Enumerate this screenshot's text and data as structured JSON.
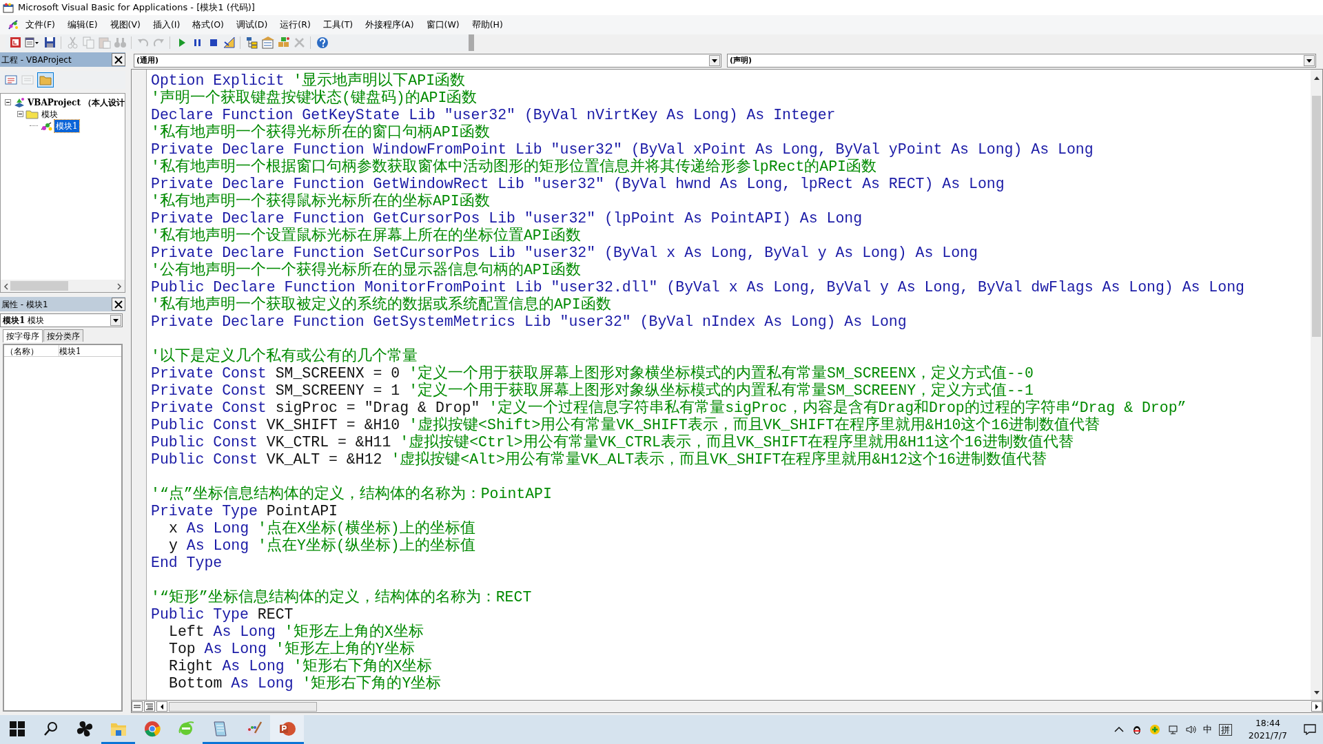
{
  "window": {
    "title": "Microsoft Visual Basic for Applications - [模块1 (代码)]"
  },
  "menu": [
    "文件(F)",
    "编辑(E)",
    "视图(V)",
    "插入(I)",
    "格式(O)",
    "调试(D)",
    "运行(R)",
    "工具(T)",
    "外接程序(A)",
    "窗口(W)",
    "帮助(H)"
  ],
  "toolbar": [
    {
      "kind": "host",
      "disabled": false
    },
    {
      "kind": "insert",
      "disabled": false
    },
    {
      "kind": "save",
      "disabled": false
    },
    {
      "kind": "separator"
    },
    {
      "kind": "cut",
      "disabled": true
    },
    {
      "kind": "copy",
      "disabled": true
    },
    {
      "kind": "paste",
      "disabled": true
    },
    {
      "kind": "find",
      "disabled": true
    },
    {
      "kind": "separator"
    },
    {
      "kind": "undo",
      "disabled": true
    },
    {
      "kind": "redo",
      "disabled": true
    },
    {
      "kind": "separator"
    },
    {
      "kind": "run",
      "disabled": false
    },
    {
      "kind": "pause",
      "disabled": false
    },
    {
      "kind": "stop",
      "disabled": false
    },
    {
      "kind": "design",
      "disabled": false
    },
    {
      "kind": "separator"
    },
    {
      "kind": "project",
      "disabled": false
    },
    {
      "kind": "properties",
      "disabled": false
    },
    {
      "kind": "objects",
      "disabled": false
    },
    {
      "kind": "toolbox",
      "disabled": true
    },
    {
      "kind": "separator"
    },
    {
      "kind": "help",
      "disabled": false
    }
  ],
  "project_panel": {
    "title": "工程 - VBAProject",
    "tree": [
      {
        "label": "VBAProject （本人设计",
        "expanded": true,
        "selected": false,
        "children": [
          {
            "label": "模块",
            "expanded": true,
            "selected": false,
            "children": [
              {
                "label": "模块1",
                "selected": true
              }
            ]
          }
        ]
      }
    ]
  },
  "properties_panel": {
    "title": "属性 - 模块1",
    "object": "模块1",
    "object_type": "模块",
    "tabs": [
      {
        "label": "按字母序",
        "selected": true
      },
      {
        "label": "按分类序",
        "selected": false
      }
    ],
    "rows": [
      {
        "name": "（名称）",
        "value": "模块1"
      }
    ]
  },
  "code_window": {
    "object": "(通用)",
    "procedure": "(声明)",
    "lines": [
      {
        "kind": "statement",
        "parts": [
          {
            "kind": "keyword",
            "text": "Option Explicit "
          },
          {
            "kind": "comment",
            "text": "'显示地声明以下API函数"
          }
        ]
      },
      {
        "kind": "statement",
        "parts": [
          {
            "kind": "comment",
            "text": "'声明一个获取键盘按键状态(键盘码)的API函数"
          }
        ]
      },
      {
        "kind": "statement",
        "parts": [
          {
            "kind": "keyword",
            "text": "Declare Function GetKeyState Lib \"user32\" (ByVal nVirtKey As Long) As Integer"
          }
        ]
      },
      {
        "kind": "statement",
        "parts": [
          {
            "kind": "comment",
            "text": "'私有地声明一个获得光标所在的窗口句柄API函数"
          }
        ]
      },
      {
        "kind": "statement",
        "parts": [
          {
            "kind": "keyword",
            "text": "Private Declare Function WindowFromPoint Lib \"user32\" (ByVal xPoint As Long, ByVal yPoint As Long) As Long"
          }
        ]
      },
      {
        "kind": "statement",
        "parts": [
          {
            "kind": "comment",
            "text": "'私有地声明一个根据窗口句柄参数获取窗体中活动图形的矩形位置信息并将其传递给形参lpRect的API函数"
          }
        ]
      },
      {
        "kind": "statement",
        "parts": [
          {
            "kind": "keyword",
            "text": "Private Declare Function GetWindowRect Lib \"user32\" (ByVal hwnd As Long, lpRect As RECT) As Long"
          }
        ]
      },
      {
        "kind": "statement",
        "parts": [
          {
            "kind": "comment",
            "text": "'私有地声明一个获得鼠标光标所在的坐标API函数"
          }
        ]
      },
      {
        "kind": "statement",
        "parts": [
          {
            "kind": "keyword",
            "text": "Private Declare Function GetCursorPos Lib \"user32\" (lpPoint As PointAPI) As Long"
          }
        ]
      },
      {
        "kind": "statement",
        "parts": [
          {
            "kind": "comment",
            "text": "'私有地声明一个设置鼠标光标在屏幕上所在的坐标位置API函数"
          }
        ]
      },
      {
        "kind": "statement",
        "parts": [
          {
            "kind": "keyword",
            "text": "Private Declare Function SetCursorPos Lib \"user32\" (ByVal x As Long, ByVal y As Long) As Long"
          }
        ]
      },
      {
        "kind": "statement",
        "parts": [
          {
            "kind": "comment",
            "text": "'公有地声明一个一个获得光标所在的显示器信息句柄的API函数"
          }
        ]
      },
      {
        "kind": "statement",
        "parts": [
          {
            "kind": "keyword",
            "text": "Public Declare Function MonitorFromPoint Lib \"user32.dll\" (ByVal x As Long, ByVal y As Long, ByVal dwFlags As Long) As Long"
          }
        ]
      },
      {
        "kind": "statement",
        "parts": [
          {
            "kind": "comment",
            "text": "'私有地声明一个获取被定义的系统的数据或系统配置信息的API函数"
          }
        ]
      },
      {
        "kind": "statement",
        "parts": [
          {
            "kind": "keyword",
            "text": "Private Declare Function GetSystemMetrics Lib \"user32\" (ByVal nIndex As Long) As Long"
          }
        ]
      },
      {
        "kind": "blank"
      },
      {
        "kind": "statement",
        "parts": [
          {
            "kind": "comment",
            "text": "'以下是定义几个私有或公有的几个常量"
          }
        ]
      },
      {
        "kind": "statement",
        "parts": [
          {
            "kind": "keyword",
            "text": "Private Const "
          },
          {
            "kind": "plain",
            "text": "SM_SCREENX = 0 "
          },
          {
            "kind": "comment",
            "text": "'定义一个用于获取屏幕上图形对象横坐标模式的内置私有常量SM_SCREENX，定义方式值--0"
          }
        ]
      },
      {
        "kind": "statement",
        "parts": [
          {
            "kind": "keyword",
            "text": "Private Const "
          },
          {
            "kind": "plain",
            "text": "SM_SCREENY = 1 "
          },
          {
            "kind": "comment",
            "text": "'定义一个用于获取屏幕上图形对象纵坐标模式的内置私有常量SM_SCREENY，定义方式值--1"
          }
        ]
      },
      {
        "kind": "statement",
        "parts": [
          {
            "kind": "keyword",
            "text": "Private Const "
          },
          {
            "kind": "plain",
            "text": "sigProc = \"Drag & Drop\" "
          },
          {
            "kind": "comment",
            "text": "'定义一个过程信息字符串私有常量sigProc，内容是含有Drag和Drop的过程的字符串“Drag & Drop”"
          }
        ]
      },
      {
        "kind": "statement",
        "parts": [
          {
            "kind": "keyword",
            "text": "Public Const "
          },
          {
            "kind": "plain",
            "text": "VK_SHIFT = &H10 "
          },
          {
            "kind": "comment",
            "text": "'虚拟按键<Shift>用公有常量VK_SHIFT表示，而且VK_SHIFT在程序里就用&H10这个16进制数值代替"
          }
        ]
      },
      {
        "kind": "statement",
        "parts": [
          {
            "kind": "keyword",
            "text": "Public Const "
          },
          {
            "kind": "plain",
            "text": "VK_CTRL = &H11 "
          },
          {
            "kind": "comment",
            "text": "'虚拟按键<Ctrl>用公有常量VK_CTRL表示，而且VK_SHIFT在程序里就用&H11这个16进制数值代替"
          }
        ]
      },
      {
        "kind": "statement",
        "parts": [
          {
            "kind": "keyword",
            "text": "Public Const "
          },
          {
            "kind": "plain",
            "text": "VK_ALT = &H12 "
          },
          {
            "kind": "comment",
            "text": "'虚拟按键<Alt>用公有常量VK_ALT表示，而且VK_SHIFT在程序里就用&H12这个16进制数值代替"
          }
        ]
      },
      {
        "kind": "blank"
      },
      {
        "kind": "statement",
        "parts": [
          {
            "kind": "comment",
            "text": "'“点”坐标信息结构体的定义，结构体的名称为：PointAPI"
          }
        ]
      },
      {
        "kind": "statement",
        "parts": [
          {
            "kind": "keyword",
            "text": "Private Type "
          },
          {
            "kind": "plain",
            "text": "PointAPI"
          }
        ]
      },
      {
        "kind": "member",
        "parts": [
          {
            "kind": "plain",
            "text": "x "
          },
          {
            "kind": "keyword",
            "text": "As Long "
          },
          {
            "kind": "comment",
            "text": "'点在X坐标(横坐标)上的坐标值"
          }
        ]
      },
      {
        "kind": "member",
        "parts": [
          {
            "kind": "plain",
            "text": "y "
          },
          {
            "kind": "keyword",
            "text": "As Long "
          },
          {
            "kind": "comment",
            "text": "'点在Y坐标(纵坐标)上的坐标值"
          }
        ]
      },
      {
        "kind": "statement",
        "parts": [
          {
            "kind": "keyword",
            "text": "End Type"
          }
        ]
      },
      {
        "kind": "blank"
      },
      {
        "kind": "statement",
        "parts": [
          {
            "kind": "comment",
            "text": "'“矩形”坐标信息结构体的定义，结构体的名称为：RECT"
          }
        ]
      },
      {
        "kind": "statement",
        "parts": [
          {
            "kind": "keyword",
            "text": "Public Type "
          },
          {
            "kind": "plain",
            "text": "RECT"
          }
        ]
      },
      {
        "kind": "member",
        "parts": [
          {
            "kind": "plain",
            "text": "Left "
          },
          {
            "kind": "keyword",
            "text": "As Long "
          },
          {
            "kind": "comment",
            "text": "'矩形左上角的X坐标"
          }
        ]
      },
      {
        "kind": "member",
        "parts": [
          {
            "kind": "plain",
            "text": "Top "
          },
          {
            "kind": "keyword",
            "text": "As Long "
          },
          {
            "kind": "comment",
            "text": "'矩形左上角的Y坐标"
          }
        ]
      },
      {
        "kind": "member",
        "parts": [
          {
            "kind": "plain",
            "text": "Right "
          },
          {
            "kind": "keyword",
            "text": "As Long "
          },
          {
            "kind": "comment",
            "text": "'矩形右下角的X坐标"
          }
        ]
      },
      {
        "kind": "member",
        "parts": [
          {
            "kind": "plain",
            "text": "Bottom "
          },
          {
            "kind": "keyword",
            "text": "As Long "
          },
          {
            "kind": "comment",
            "text": "'矩形右下角的Y坐标"
          }
        ]
      }
    ]
  },
  "taskbar": {
    "apps": [
      {
        "kind": "start",
        "running": false,
        "active": false
      },
      {
        "kind": "search",
        "running": false,
        "active": false
      },
      {
        "kind": "pinwheel",
        "running": false,
        "active": false
      },
      {
        "kind": "folder",
        "running": true,
        "active": false
      },
      {
        "kind": "chrome",
        "running": false,
        "active": false
      },
      {
        "kind": "ie",
        "running": false,
        "active": false
      },
      {
        "kind": "notepad",
        "running": true,
        "active": false
      },
      {
        "kind": "paint",
        "running": true,
        "active": false
      },
      {
        "kind": "slides",
        "running": true,
        "active": true
      }
    ],
    "tray": {
      "ime_mode": "中",
      "ime": "拼",
      "time": "18:44",
      "date": "2021/7/7"
    }
  }
}
